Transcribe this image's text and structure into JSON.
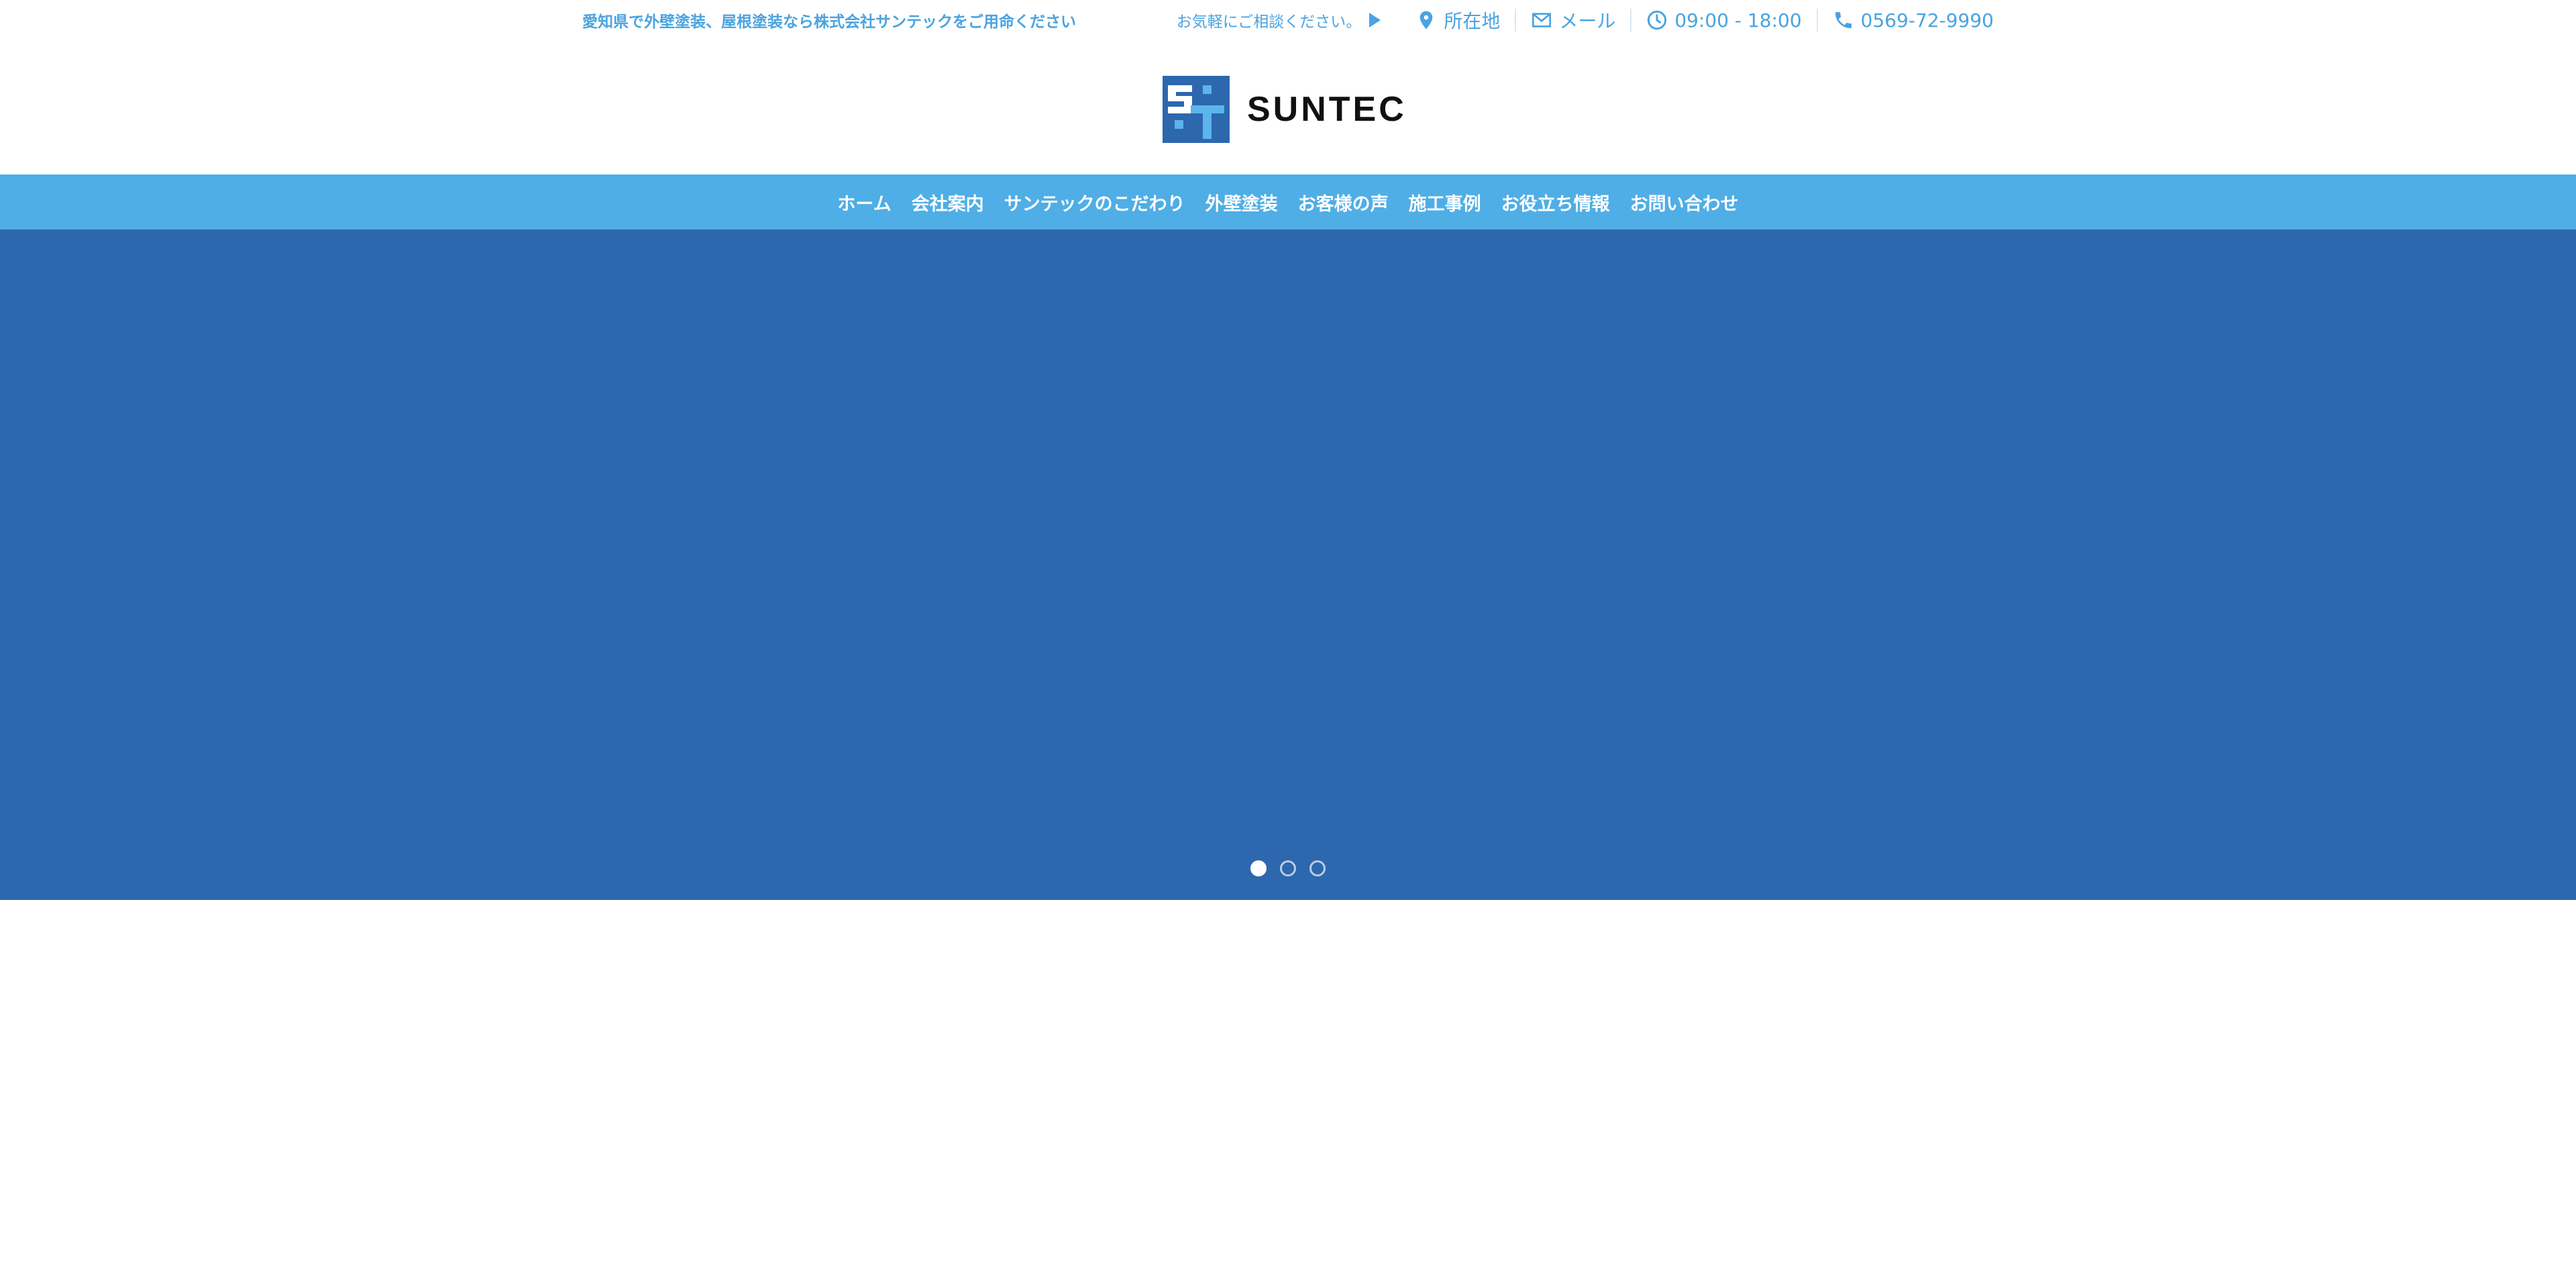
{
  "header": {
    "tagline": "愛知県で外壁塗装、屋根塗装なら株式会社サンテックをご用命ください",
    "contact_lead": "お気軽にご相談ください。",
    "contact_items": [
      {
        "icon": "map-pin-icon",
        "label": "所在地"
      },
      {
        "icon": "mail-icon",
        "label": "メール"
      },
      {
        "icon": "clock-icon",
        "label": "09:00 - 18:00"
      },
      {
        "icon": "phone-icon",
        "label": "0569-72-9990"
      }
    ],
    "logo_text": "SUNTEC"
  },
  "nav": {
    "items": [
      {
        "label": "ホーム"
      },
      {
        "label": "会社案内"
      },
      {
        "label": "サンテックのこだわり"
      },
      {
        "label": "外壁塗装"
      },
      {
        "label": "お客様の声"
      },
      {
        "label": "施工事例"
      },
      {
        "label": "お役立ち情報"
      },
      {
        "label": "お問い合わせ"
      }
    ]
  },
  "hero": {
    "slide_count": 3,
    "active_slide": 1
  },
  "colors": {
    "accent": "#4aa3e0",
    "nav_background": "#4faee6",
    "hero_background": "#2d67ae",
    "logo_dark": "#2d67ae",
    "logo_light": "#5bb4ea",
    "logo_text": "#111111"
  }
}
